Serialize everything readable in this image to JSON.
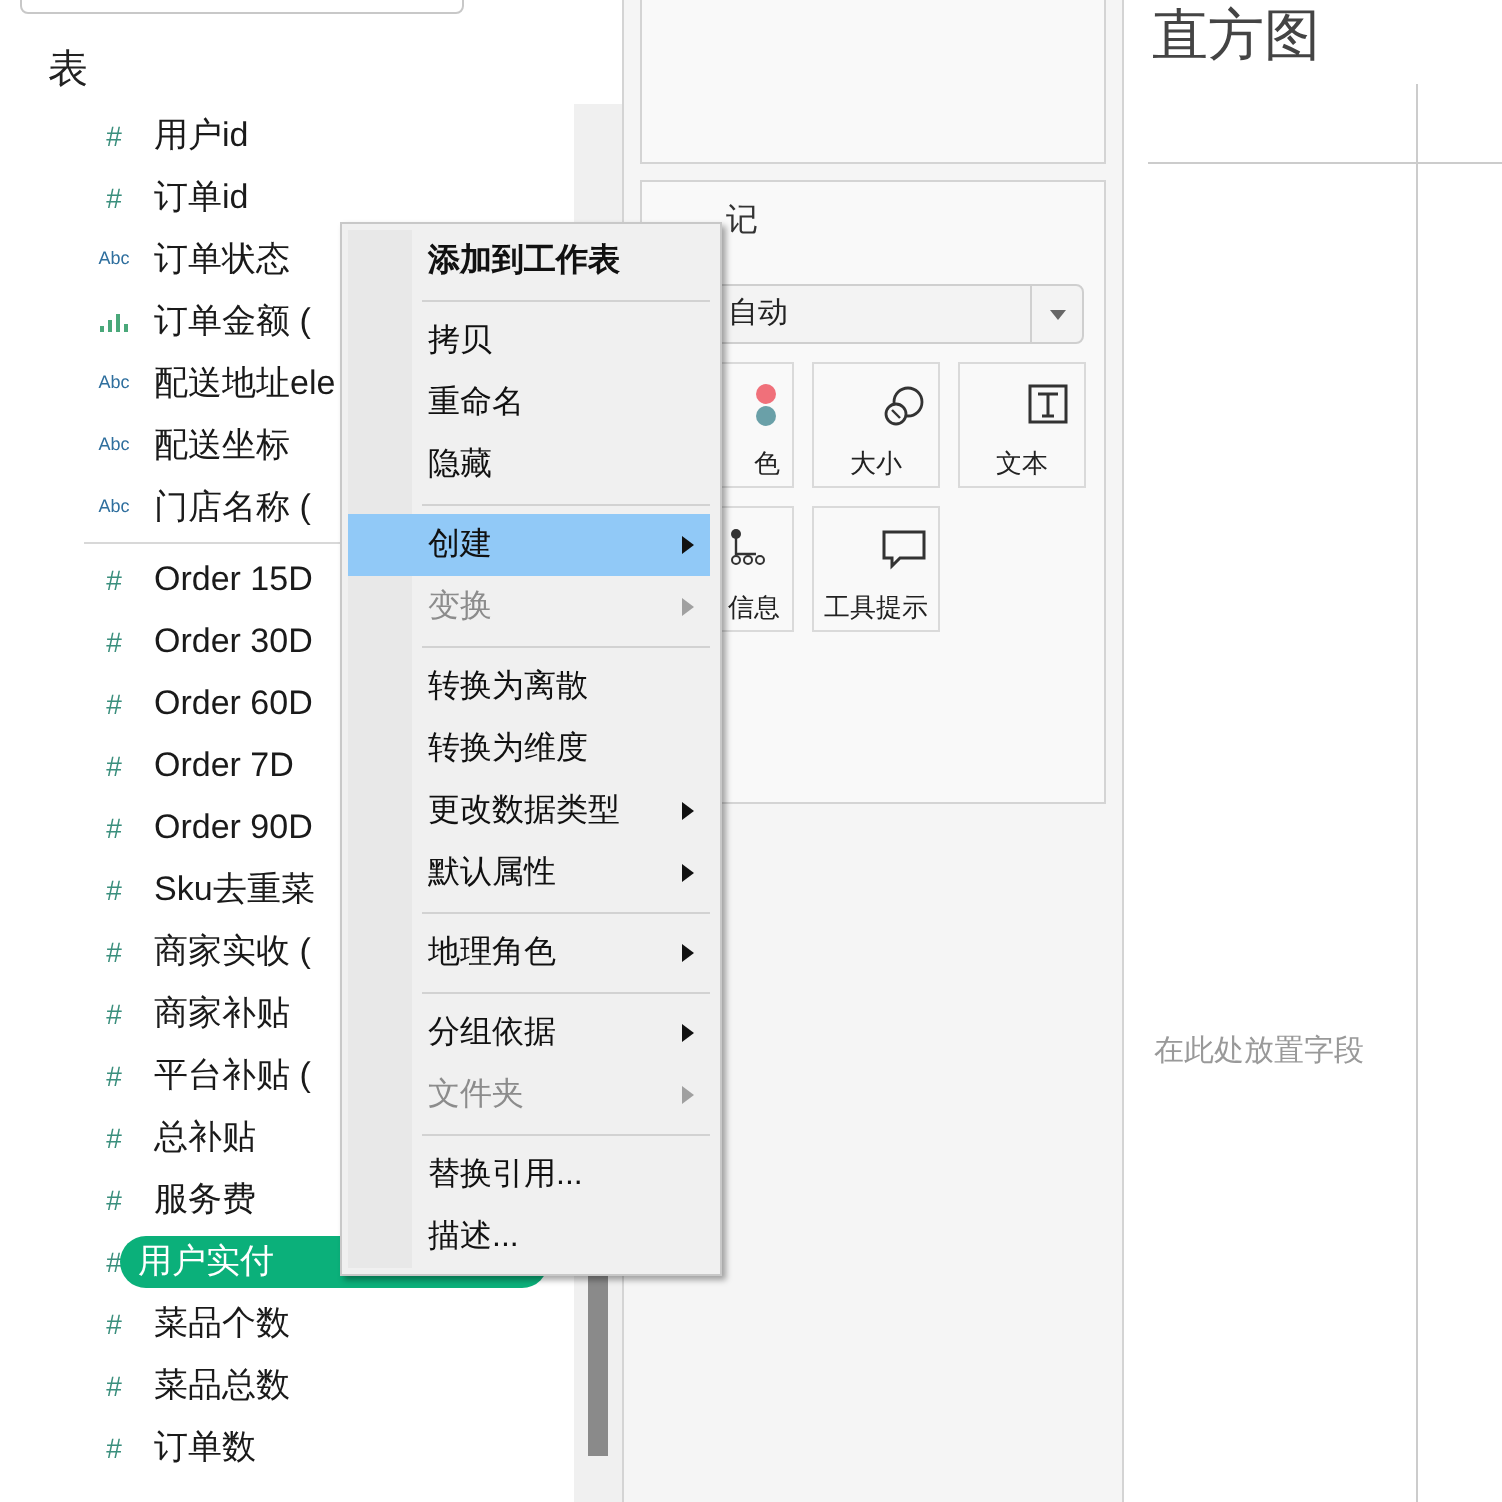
{
  "data_pane": {
    "section_title": "表",
    "groups": [
      [
        {
          "kind": "number",
          "icon": "#",
          "label": "用户id",
          "selected": false
        },
        {
          "kind": "number",
          "icon": "#",
          "label": "订单id",
          "selected": false
        },
        {
          "kind": "text",
          "icon": "Abc",
          "label": "订单状态",
          "selected": false
        },
        {
          "kind": "bin",
          "label": "订单金额 (",
          "selected": false
        },
        {
          "kind": "text",
          "icon": "Abc",
          "label": "配送地址ele",
          "selected": false
        },
        {
          "kind": "text",
          "icon": "Abc",
          "label": "配送坐标",
          "selected": false
        },
        {
          "kind": "text",
          "icon": "Abc",
          "label": "门店名称 (",
          "selected": false
        }
      ],
      [
        {
          "kind": "number",
          "icon": "#",
          "label": "Order 15D",
          "selected": false
        },
        {
          "kind": "number",
          "icon": "#",
          "label": "Order 30D",
          "selected": false
        },
        {
          "kind": "number",
          "icon": "#",
          "label": "Order 60D",
          "selected": false
        },
        {
          "kind": "number",
          "icon": "#",
          "label": "Order 7D",
          "selected": false
        },
        {
          "kind": "number",
          "icon": "#",
          "label": "Order 90D",
          "selected": false
        },
        {
          "kind": "number",
          "icon": "#",
          "label": "Sku去重菜",
          "selected": false
        },
        {
          "kind": "number",
          "icon": "#",
          "label": "商家实收 (",
          "selected": false
        },
        {
          "kind": "number",
          "icon": "#",
          "label": "商家补贴",
          "selected": false
        },
        {
          "kind": "number",
          "icon": "#",
          "label": "平台补贴 (",
          "selected": false
        },
        {
          "kind": "number",
          "icon": "#",
          "label": "总补贴",
          "selected": false
        },
        {
          "kind": "number",
          "icon": "#",
          "label": "服务费",
          "selected": false
        },
        {
          "kind": "number",
          "icon": "#",
          "label": "用户实付",
          "selected": true
        },
        {
          "kind": "number",
          "icon": "#",
          "label": "菜品个数",
          "selected": false
        },
        {
          "kind": "number",
          "icon": "#",
          "label": "菜品总数",
          "selected": false
        },
        {
          "kind": "number",
          "icon": "#",
          "label": "订单数",
          "selected": false
        }
      ]
    ]
  },
  "marks_card": {
    "title": "记",
    "mark_type": "自动",
    "buttons": [
      {
        "kind": "color",
        "label": "色"
      },
      {
        "kind": "size",
        "label": "大小"
      },
      {
        "kind": "text",
        "label": "文本"
      },
      {
        "kind": "detail",
        "label": "信息"
      },
      {
        "kind": "tooltip",
        "label": "工具提示"
      }
    ]
  },
  "view": {
    "title": "直方图",
    "drop_hint": "在此处放置字段"
  },
  "context_menu": [
    {
      "kind": "item",
      "label": "添加到工作表",
      "bold": true,
      "selected": false,
      "disabled": false,
      "submenu": false
    },
    {
      "kind": "separator"
    },
    {
      "kind": "item",
      "label": "拷贝",
      "bold": false,
      "selected": false,
      "disabled": false,
      "submenu": false
    },
    {
      "kind": "item",
      "label": "重命名",
      "bold": false,
      "selected": false,
      "disabled": false,
      "submenu": false
    },
    {
      "kind": "item",
      "label": "隐藏",
      "bold": false,
      "selected": false,
      "disabled": false,
      "submenu": false
    },
    {
      "kind": "separator"
    },
    {
      "kind": "item",
      "label": "创建",
      "bold": false,
      "selected": true,
      "disabled": false,
      "submenu": true
    },
    {
      "kind": "item",
      "label": "变换",
      "bold": false,
      "selected": false,
      "disabled": true,
      "submenu": true
    },
    {
      "kind": "separator"
    },
    {
      "kind": "item",
      "label": "转换为离散",
      "bold": false,
      "selected": false,
      "disabled": false,
      "submenu": false
    },
    {
      "kind": "item",
      "label": "转换为维度",
      "bold": false,
      "selected": false,
      "disabled": false,
      "submenu": false
    },
    {
      "kind": "item",
      "label": "更改数据类型",
      "bold": false,
      "selected": false,
      "disabled": false,
      "submenu": true
    },
    {
      "kind": "item",
      "label": "默认属性",
      "bold": false,
      "selected": false,
      "disabled": false,
      "submenu": true
    },
    {
      "kind": "separator"
    },
    {
      "kind": "item",
      "label": "地理角色",
      "bold": false,
      "selected": false,
      "disabled": false,
      "submenu": true
    },
    {
      "kind": "separator"
    },
    {
      "kind": "item",
      "label": "分组依据",
      "bold": false,
      "selected": false,
      "disabled": false,
      "submenu": true
    },
    {
      "kind": "item",
      "label": "文件夹",
      "bold": false,
      "selected": false,
      "disabled": true,
      "submenu": true
    },
    {
      "kind": "separator"
    },
    {
      "kind": "item",
      "label": "替换引用...",
      "bold": false,
      "selected": false,
      "disabled": false,
      "submenu": false
    },
    {
      "kind": "item",
      "label": "描述...",
      "bold": false,
      "selected": false,
      "disabled": false,
      "submenu": false
    }
  ]
}
